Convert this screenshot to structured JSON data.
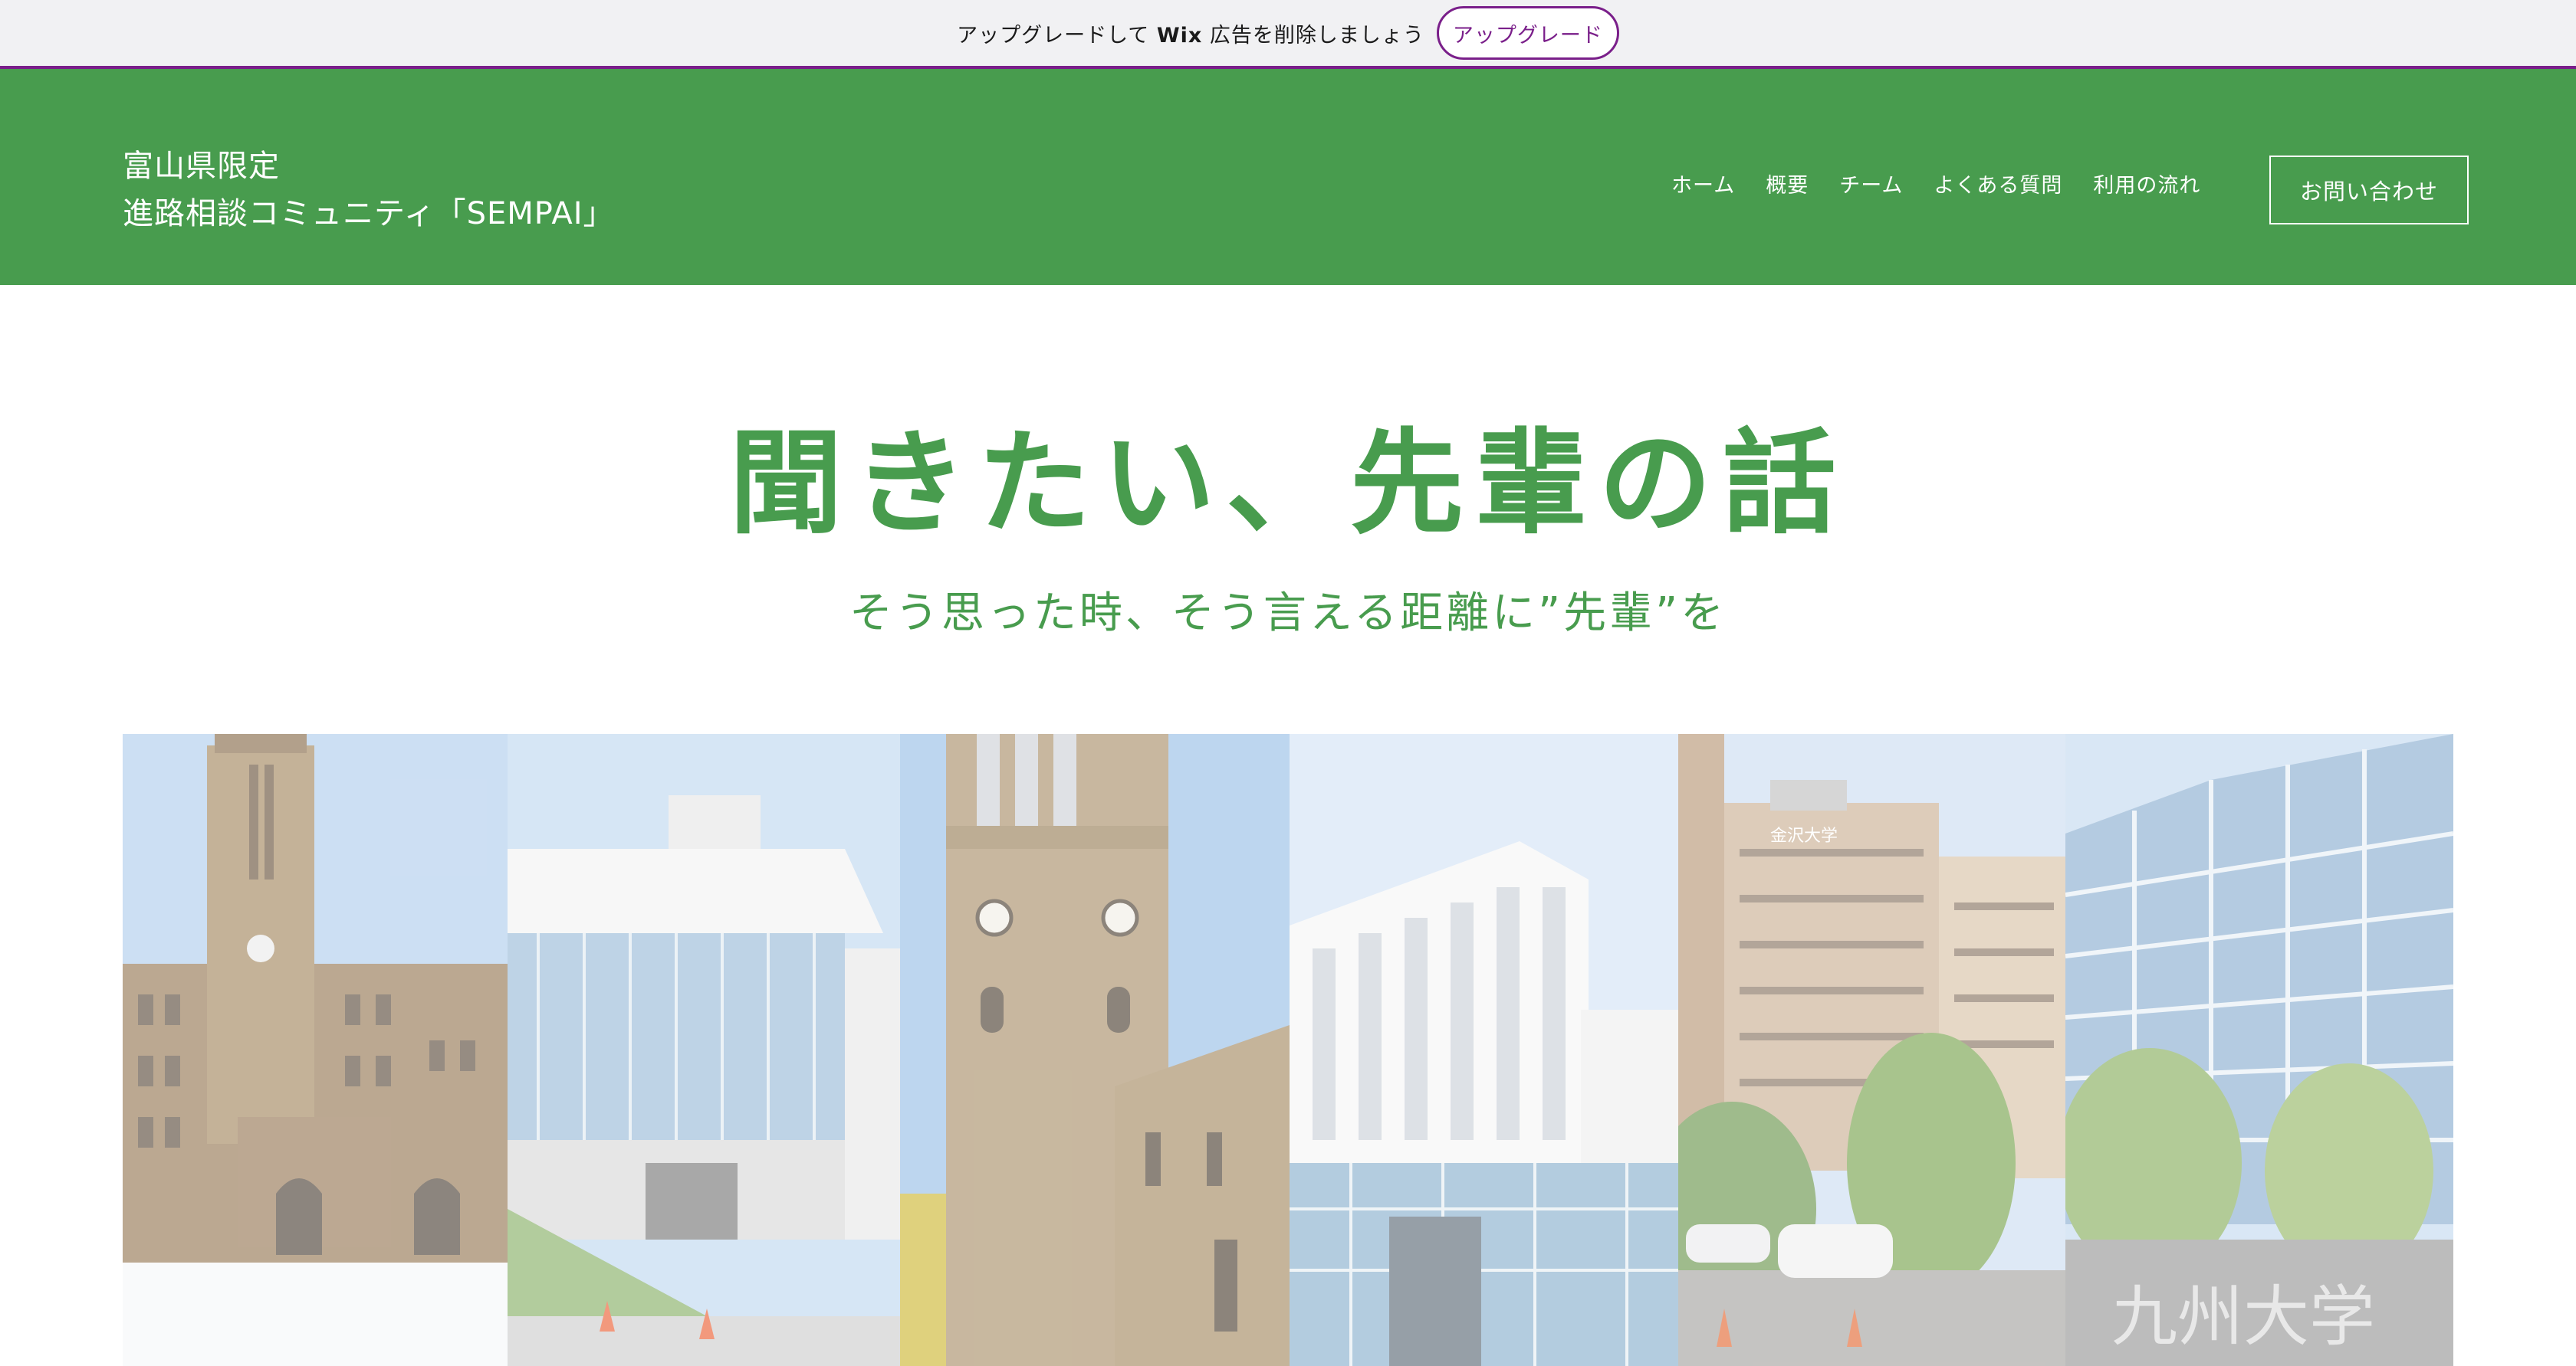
{
  "promo": {
    "text_before": "アップグレードして ",
    "brand": "Wix",
    "text_after": " 広告を削除しましょう",
    "button_label": "アップグレード"
  },
  "header": {
    "title_line1": "富山県限定",
    "title_line2": "進路相談コミュニティ「SEMPAI」",
    "nav": [
      "ホーム",
      "概要",
      "チーム",
      "よくある質問",
      "利用の流れ"
    ],
    "contact_label": "お問い合わせ"
  },
  "hero": {
    "title": "聞きたい、先輩の話",
    "subtitle": "そう思った時、そう言える距離に”先輩”を"
  },
  "photos": {
    "sign_text": "九州大学",
    "building_sign": "金沢大学"
  },
  "colors": {
    "accent_green": "#489c4e",
    "promo_purple": "#7a1f8a"
  }
}
